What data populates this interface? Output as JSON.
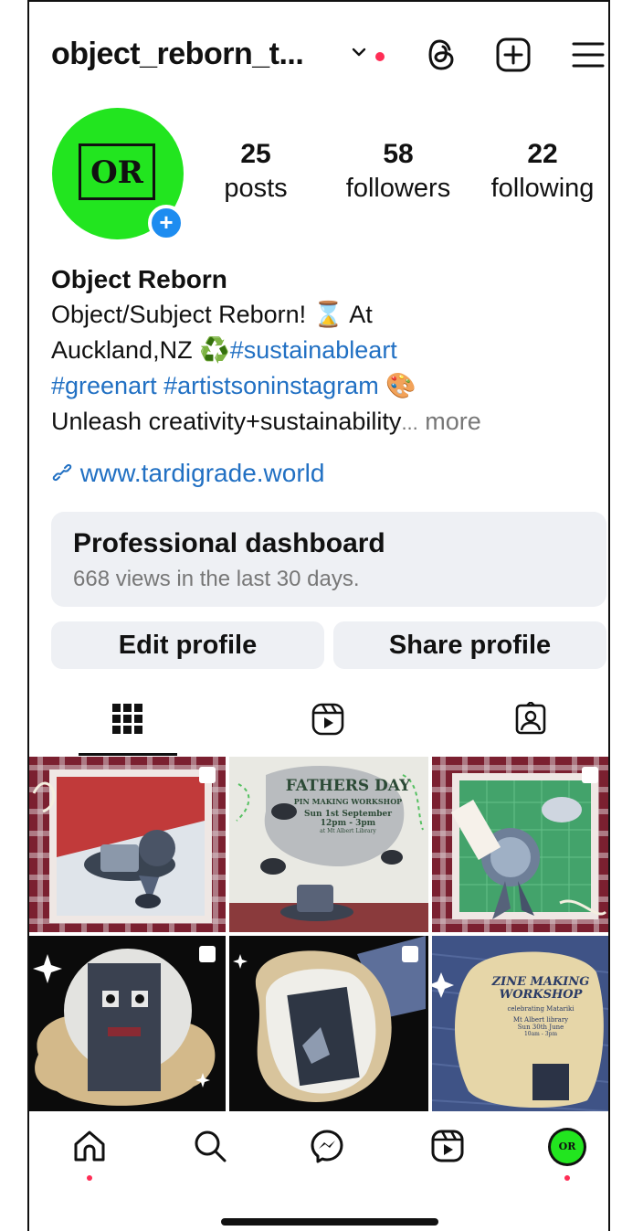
{
  "header": {
    "username": "object_reborn_t...",
    "icons": [
      "chevron-down-icon",
      "threads-icon",
      "create-plus-icon",
      "menu-icon"
    ]
  },
  "profile": {
    "avatar_text": "OR",
    "stats": [
      {
        "value": "25",
        "label": "posts"
      },
      {
        "value": "58",
        "label": "followers"
      },
      {
        "value": "22",
        "label": "following"
      }
    ]
  },
  "bio": {
    "name": "Object Reborn",
    "line1_text": "Object/Subject Reborn! ⌛ At",
    "line2_text": "Auckland,NZ ♻️",
    "line2_tag": "#sustainableart",
    "line3_tags": "#greenart #artistsoninstagram",
    "line3_emoji": "🎨",
    "line4_text": "Unleash creativity+sustainability",
    "line4_ellipsis": "...",
    "more": "more",
    "link": "www.tardigrade.world"
  },
  "dashboard": {
    "title": "Professional dashboard",
    "subtitle": "668 views in the last 30 days."
  },
  "buttons": {
    "edit": "Edit profile",
    "share": "Share profile"
  },
  "tabs": [
    "grid-icon",
    "reels-icon",
    "tagged-icon"
  ],
  "posts": [
    {
      "name": "post-recycled-hat-sculpture",
      "multi": true
    },
    {
      "name": "post-fathers-day-workshop",
      "title": "FATHERS DAY",
      "subtitle": "PIN MAKING WORKSHOP",
      "date": "Sun 1st September",
      "time": "12pm - 3pm",
      "place": "at Mt Albert Library",
      "multi": false
    },
    {
      "name": "post-denim-rosette-pin",
      "multi": true
    },
    {
      "name": "post-space-figure-collage",
      "multi": true
    },
    {
      "name": "post-denim-cutout-collage",
      "multi": true
    },
    {
      "name": "post-zine-making-workshop",
      "title": "ZINE MAKING WORKSHOP",
      "subtitle": "celebrating Matariki",
      "place": "Mt Albert library",
      "date": "Sun 30th June",
      "time": "10am - 3pm",
      "multi": false
    }
  ],
  "nav": [
    "home-icon",
    "search-icon",
    "messenger-icon",
    "reels-icon",
    "profile-avatar"
  ],
  "nav_avatar_text": "OR",
  "colors": {
    "accent_green": "#22e51f",
    "link_blue": "#2170c3",
    "notify_red": "#ff2d55",
    "badge_blue": "#1d8cf0"
  }
}
